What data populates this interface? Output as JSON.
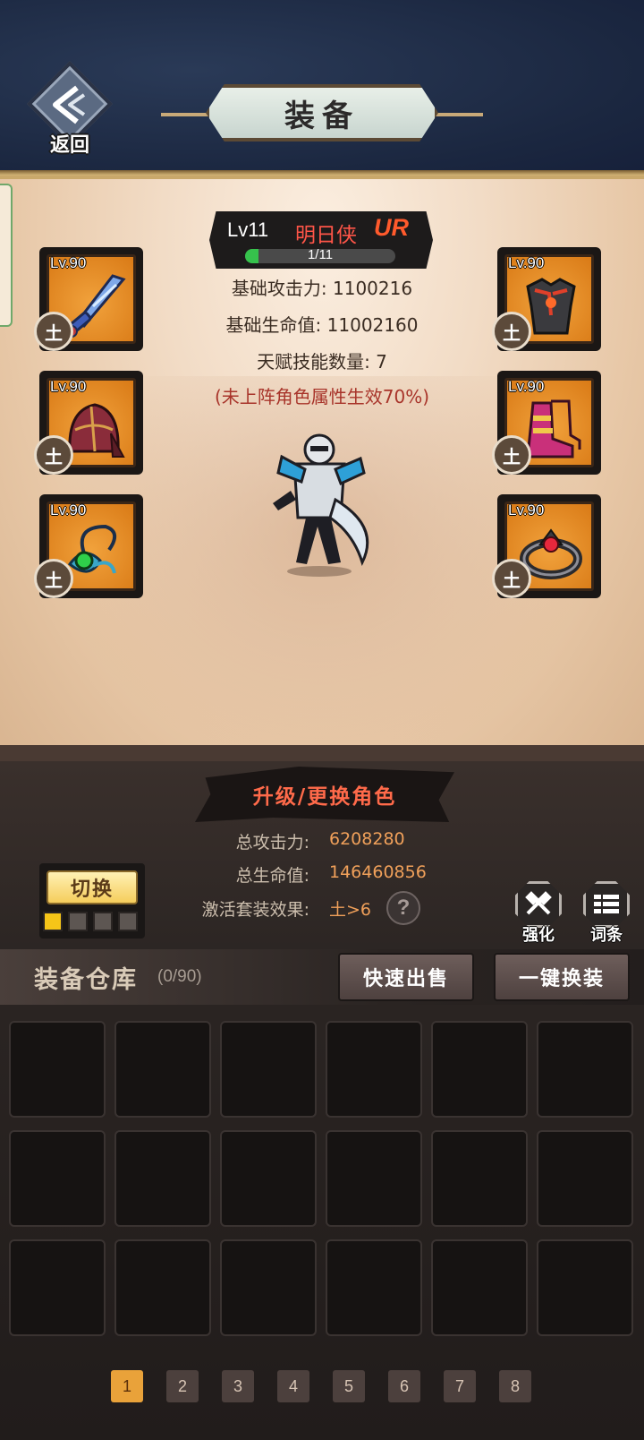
{
  "header": {
    "back_label": "返回",
    "title": "装备"
  },
  "character": {
    "level_label": "Lv11",
    "name": "明日侠",
    "rank": "UR",
    "progress_text": "1/11",
    "progress_fraction": 0.0909,
    "stats": {
      "base_attack": "基础攻击力: 1100216",
      "base_hp": "基础生命值: 11002160",
      "talent_count": "天赋技能数量: 7",
      "inactive_hint": "(未上阵角色属性生效70%)"
    }
  },
  "equipment": {
    "left": [
      {
        "level": "Lv.90",
        "element": "土",
        "icon": "sword-icon"
      },
      {
        "level": "Lv.90",
        "element": "土",
        "icon": "helmet-icon"
      },
      {
        "level": "Lv.90",
        "element": "土",
        "icon": "amulet-icon"
      }
    ],
    "right": [
      {
        "level": "Lv.90",
        "element": "土",
        "icon": "armor-icon"
      },
      {
        "level": "Lv.90",
        "element": "土",
        "icon": "boots-icon"
      },
      {
        "level": "Lv.90",
        "element": "土",
        "icon": "ring-icon"
      }
    ]
  },
  "summary": {
    "upgrade_button": "升级/更换角色",
    "total_attack_label": "总攻击力:",
    "total_attack_value": "6208280",
    "total_hp_label": "总生命值:",
    "total_hp_value": "146460856",
    "set_effect_label": "激活套装效果:",
    "set_effect_value": "土>6",
    "help_symbol": "?"
  },
  "switch": {
    "label": "切换",
    "active_index": 0,
    "count": 4
  },
  "tools": {
    "enhance": "强化",
    "affix": "词条"
  },
  "storage": {
    "title": "装备仓库",
    "count": "(0/90)",
    "quick_sell": "快速出售",
    "one_click_equip": "一键换装",
    "rows": 3,
    "cols": 6
  },
  "pagination": {
    "pages": [
      "1",
      "2",
      "3",
      "4",
      "5",
      "6",
      "7",
      "8"
    ],
    "current": "1"
  },
  "colors": {
    "accent_gold": "#e9a23a",
    "name_red": "#ff5548",
    "value_orange": "#f0a05a",
    "progress_green": "#36c24c",
    "slot_orange": "#d97a16"
  }
}
